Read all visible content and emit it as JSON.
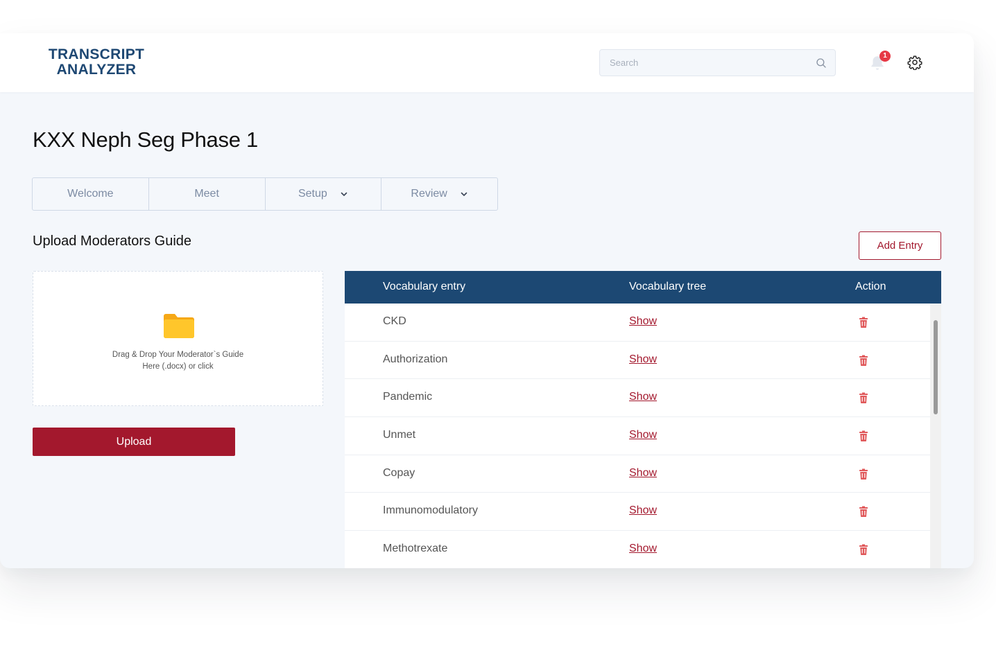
{
  "app": {
    "logo_line1": "TRANSCRIPT",
    "logo_line2": "ANALYZER"
  },
  "header": {
    "search_placeholder": "Search",
    "notification_count": "1"
  },
  "page": {
    "title": "KXX Neph Seg Phase 1"
  },
  "tabs": [
    {
      "label": "Welcome",
      "dropdown": false
    },
    {
      "label": "Meet",
      "dropdown": false
    },
    {
      "label": "Setup",
      "dropdown": true
    },
    {
      "label": "Review",
      "dropdown": true
    }
  ],
  "upload": {
    "section_title": "Upload Moderators Guide",
    "drop_line1": "Drag & Drop Your Moderator`s Guide",
    "drop_line2": "Here (.docx) or click",
    "button_label": "Upload"
  },
  "vocabulary": {
    "add_button_label": "Add Entry",
    "columns": {
      "entry": "Vocabulary entry",
      "tree": "Vocabulary tree",
      "action": "Action"
    },
    "rows": [
      {
        "entry": "CKD",
        "tree": "Show"
      },
      {
        "entry": "Authorization",
        "tree": "Show"
      },
      {
        "entry": "Pandemic",
        "tree": "Show"
      },
      {
        "entry": "Unmet",
        "tree": "Show"
      },
      {
        "entry": "Copay",
        "tree": "Show"
      },
      {
        "entry": "Immunomodulatory",
        "tree": "Show"
      },
      {
        "entry": "Methotrexate",
        "tree": "Show"
      }
    ]
  },
  "colors": {
    "brand_blue": "#1c4873",
    "accent_red": "#a3182d",
    "badge_red": "#e63946"
  }
}
